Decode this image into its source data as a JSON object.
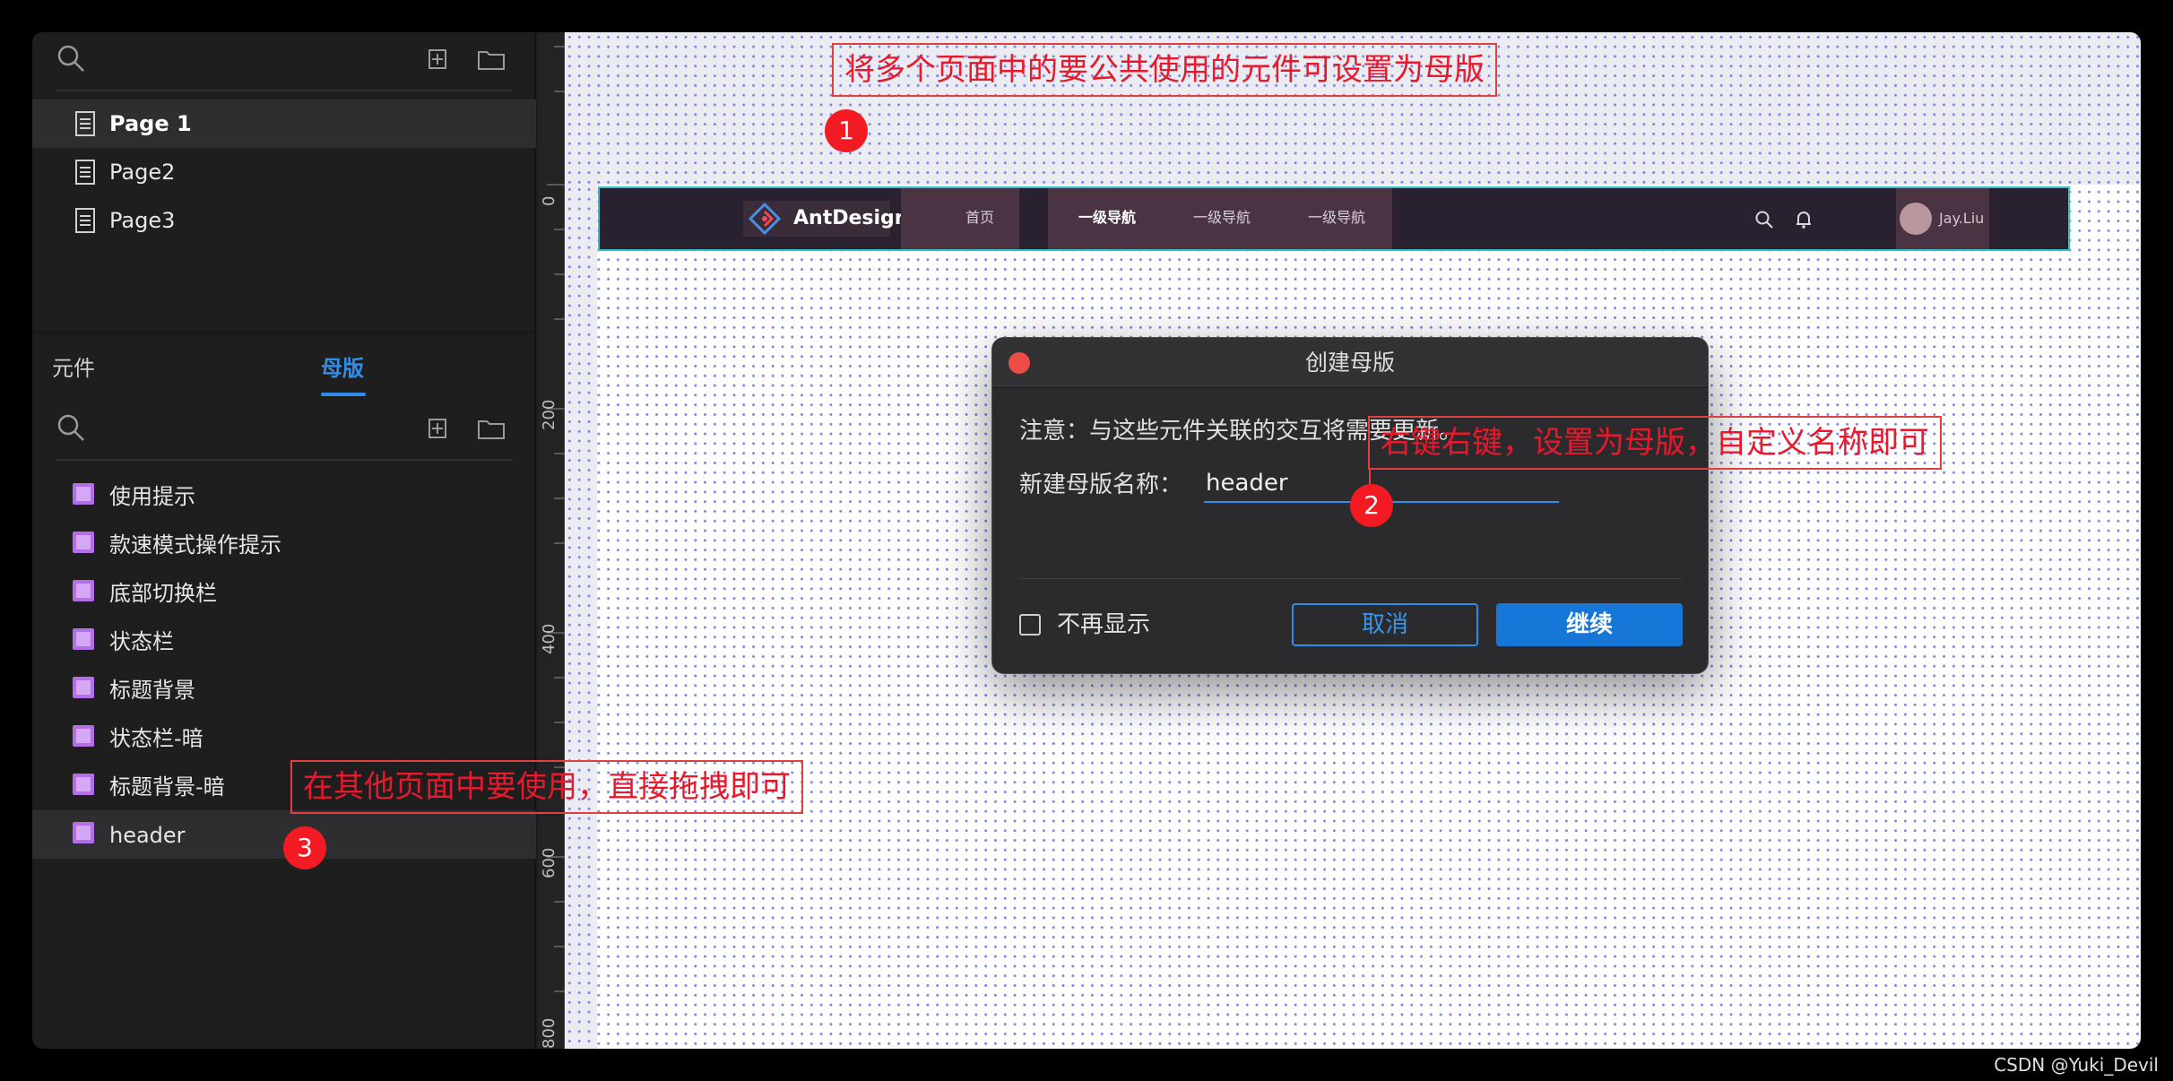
{
  "left_panel": {
    "pages": [
      {
        "label": "Page 1",
        "active": true
      },
      {
        "label": "Page2",
        "active": false
      },
      {
        "label": "Page3",
        "active": false
      }
    ],
    "tabs": [
      {
        "label": "元件",
        "active": false
      },
      {
        "label": "母版",
        "active": true
      }
    ],
    "masters": [
      {
        "label": "使用提示"
      },
      {
        "label": "款速模式操作提示"
      },
      {
        "label": "底部切换栏"
      },
      {
        "label": "状态栏"
      },
      {
        "label": "标题背景"
      },
      {
        "label": "状态栏-暗"
      },
      {
        "label": "标题背景-暗"
      },
      {
        "label": "header",
        "active": true
      }
    ]
  },
  "ruler": {
    "labels": [
      "0",
      "200",
      "400",
      "600",
      "800"
    ]
  },
  "header_master": {
    "logo_text": "AntDesign",
    "nav": [
      "首页",
      "一级导航",
      "一级导航",
      "一级导航"
    ],
    "user_name": "Jay.Liu"
  },
  "dialog": {
    "title": "创建母版",
    "note": "注意：与这些元件关联的交互将需要更新。",
    "name_label": "新建母版名称：",
    "name_value": "header",
    "checkbox_label": "不再显示",
    "cancel_label": "取消",
    "continue_label": "继续"
  },
  "annotations": {
    "callout_1": "将多个页面中的要公共使用的元件可设置为母版",
    "callout_2": "右键右键，设置为母版，自定义名称即可",
    "callout_3": "在其他页面中要使用，直接拖拽即可",
    "badge_1": "1",
    "badge_2": "2",
    "badge_3": "3"
  },
  "colors": {
    "accent": "#2f8eea",
    "annotation_red": "#e8192c",
    "master_icon": "#b36ee8"
  },
  "watermark": "CSDN @Yuki_Devil"
}
